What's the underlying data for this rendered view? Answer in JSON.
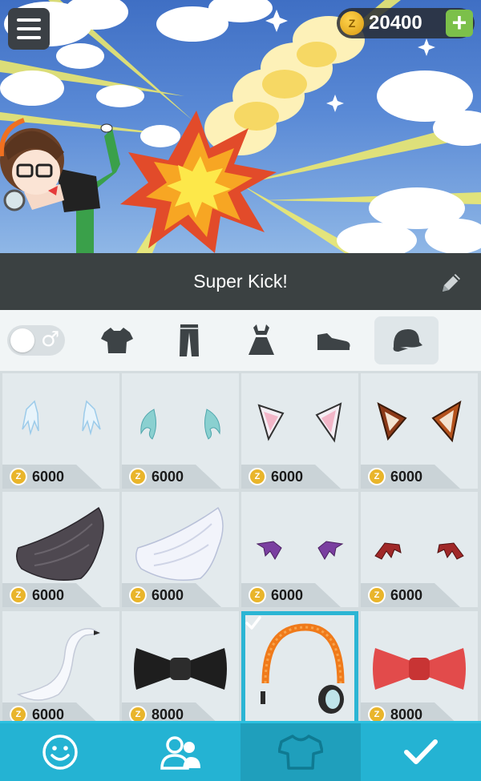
{
  "header": {
    "coin_balance": "20400",
    "plus_label": "+"
  },
  "title_bar": {
    "title": "Super Kick!"
  },
  "category_tabs": [
    {
      "name": "gender-toggle",
      "symbol": "♂"
    },
    {
      "name": "shirt-icon"
    },
    {
      "name": "pants-icon"
    },
    {
      "name": "dress-icon"
    },
    {
      "name": "shoe-icon"
    },
    {
      "name": "cap-icon",
      "active": true
    },
    {
      "name": "bikini-icon"
    }
  ],
  "items": [
    {
      "name": "ice-wings",
      "price": "6000"
    },
    {
      "name": "fairy-wings",
      "price": "6000"
    },
    {
      "name": "cat-ears",
      "price": "6000"
    },
    {
      "name": "fox-ears",
      "price": "6000"
    },
    {
      "name": "dark-wing",
      "price": "6000"
    },
    {
      "name": "angel-wing",
      "price": "6000"
    },
    {
      "name": "purple-mini-wings",
      "price": "6000"
    },
    {
      "name": "bat-wings",
      "price": "6000"
    },
    {
      "name": "swan",
      "price": "6000"
    },
    {
      "name": "black-bow-tie",
      "price": "8000"
    },
    {
      "name": "orange-headphones",
      "price": "",
      "selected": true
    },
    {
      "name": "red-bow",
      "price": "8000"
    }
  ],
  "bottom_nav": [
    {
      "name": "face",
      "icon": "smiley-icon"
    },
    {
      "name": "friends",
      "icon": "people-icon"
    },
    {
      "name": "outfit",
      "icon": "shirt-icon",
      "active": true
    },
    {
      "name": "confirm",
      "icon": "checkmark-icon"
    }
  ],
  "colors": {
    "accent": "#24b3d3",
    "selected_border": "#2bb5d4",
    "title_bar": "#3b4142",
    "plus_green": "#7cc04a",
    "coin_gold": "#e9b52b"
  }
}
